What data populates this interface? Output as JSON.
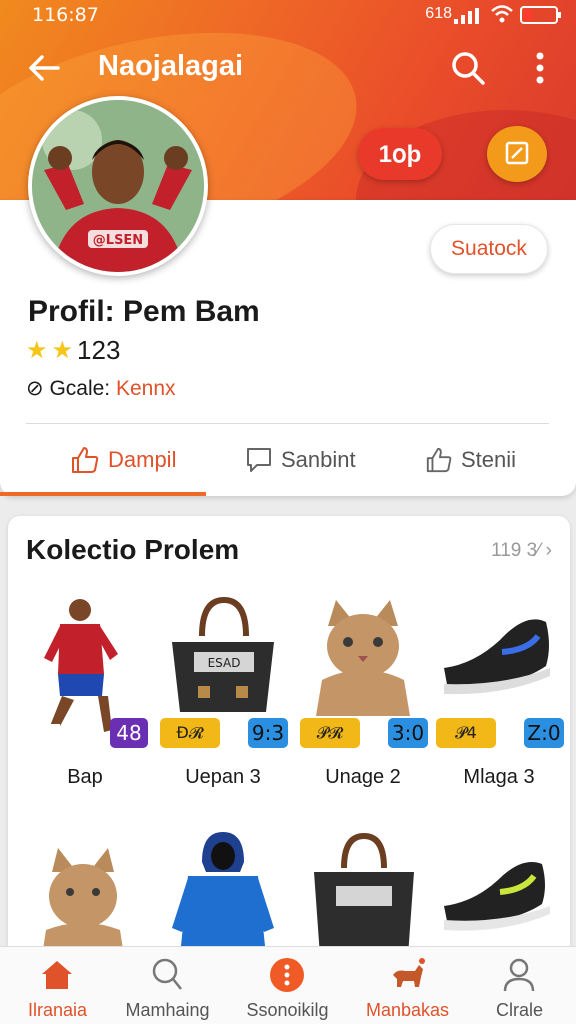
{
  "status_bar": {
    "time": "116:87",
    "network": "618"
  },
  "header": {
    "title": "Naojalagai"
  },
  "profile": {
    "top_button": "1օþ",
    "subscribe_button": "Suatock",
    "name": "Profil: Pem Bam",
    "rating": "123",
    "goal_label": "Gcale:",
    "goal_value": "Kennx",
    "tabs": [
      {
        "label": "Dampil",
        "active": true
      },
      {
        "label": "Sanbint",
        "active": false
      },
      {
        "label": "Stenii",
        "active": false
      }
    ]
  },
  "collection": {
    "title": "Kolectio Prolem",
    "count": "119 3⁄",
    "items": [
      {
        "label": "Bap",
        "badge": "48",
        "icon": "footballer-image"
      },
      {
        "label": "Uepan 3",
        "badge_left": "Ð𝓡",
        "badge_right": "9:3",
        "icon": "bag-image"
      },
      {
        "label": "Unage 2",
        "badge_left": "𝓟𝓡",
        "badge_right": "3:0",
        "icon": "cat-image"
      },
      {
        "label": "Mlaga 3",
        "badge_left": "𝓟4",
        "badge_right": "Z:0",
        "icon": "sneaker-image"
      }
    ]
  },
  "bottom_nav": [
    {
      "label": "Ilranaia",
      "icon": "home-icon",
      "active": true
    },
    {
      "label": "Mamhaing",
      "icon": "search-person-icon",
      "active": false
    },
    {
      "label": "Ssonoikilg",
      "icon": "info-icon",
      "active": false
    },
    {
      "label": "Manbakas",
      "icon": "dog-icon",
      "active": true
    },
    {
      "label": "Clrale",
      "icon": "profile-icon",
      "active": false
    }
  ],
  "colors": {
    "accent": "#e0522a",
    "header_start": "#f08a1e",
    "header_end": "#d63a2c"
  }
}
